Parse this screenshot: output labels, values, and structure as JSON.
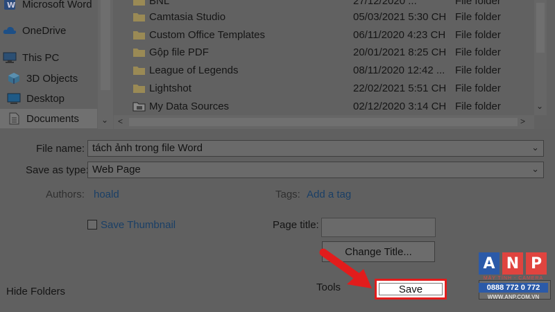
{
  "sidebar": {
    "items": [
      {
        "label": "Microsoft Word",
        "icon": "word-icon"
      },
      {
        "label": "OneDrive",
        "icon": "cloud-icon"
      },
      {
        "label": "This PC",
        "icon": "computer-icon"
      },
      {
        "label": "3D Objects",
        "icon": "cube-icon"
      },
      {
        "label": "Desktop",
        "icon": "desktop-icon"
      },
      {
        "label": "Documents",
        "icon": "document-icon",
        "selected": true
      }
    ]
  },
  "files": {
    "rows": [
      {
        "name": "BNL",
        "date": "27/12/2020 ...",
        "type": "File folder"
      },
      {
        "name": "Camtasia Studio",
        "date": "05/03/2021 5:30 CH",
        "type": "File folder"
      },
      {
        "name": "Custom Office Templates",
        "date": "06/11/2020 4:23 CH",
        "type": "File folder"
      },
      {
        "name": "Gộp file PDF",
        "date": "20/01/2021 8:25 CH",
        "type": "File folder"
      },
      {
        "name": "League of Legends",
        "date": "08/11/2020 12:42 ...",
        "type": "File folder"
      },
      {
        "name": "Lightshot",
        "date": "22/02/2021 5:51 CH",
        "type": "File folder"
      },
      {
        "name": "My Data Sources",
        "date": "02/12/2020 3:14 CH",
        "type": "File folder"
      }
    ]
  },
  "form": {
    "file_name_label": "File name:",
    "file_name_value": "tách ảnh trong file Word",
    "save_type_label": "Save as type:",
    "save_type_value": "Web Page",
    "authors_label": "Authors:",
    "authors_value": "hoald",
    "tags_label": "Tags:",
    "tags_value": "Add a tag",
    "save_thumbnail_label": "Save Thumbnail",
    "page_title_label": "Page title:",
    "change_title_label": "Change Title...",
    "hide_folders_label": "Hide Folders",
    "tools_label": "Tools",
    "save_label": "Save"
  },
  "watermark": {
    "letters": [
      "A",
      "N",
      "P"
    ],
    "tagline": "MÁY TÍNH - CAMERA",
    "phone": "0888 772 0 772",
    "website": "WWW.ANP.COM.VN"
  },
  "colors": {
    "highlight": "#e21c1c",
    "arrow": "#e21c1c",
    "link": "#1a3f66",
    "logo_a": "#2b5aa8",
    "logo_n": "#e0443f",
    "logo_p": "#e0443f"
  }
}
